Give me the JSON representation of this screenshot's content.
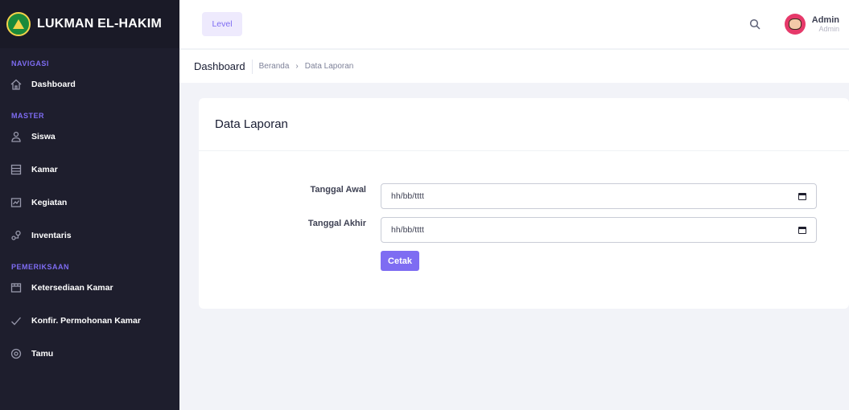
{
  "brand": {
    "name": "LUKMAN EL-HAKIM"
  },
  "header": {
    "level_label": "Level",
    "user_name": "Admin",
    "user_role": "Admin"
  },
  "sidebar": {
    "sections": [
      {
        "title": "NAVIGASI",
        "items": [
          {
            "label": "Dashboard",
            "icon": "home-icon"
          }
        ]
      },
      {
        "title": "MASTER",
        "items": [
          {
            "label": "Siswa",
            "icon": "user-icon"
          },
          {
            "label": "Kamar",
            "icon": "list-icon"
          },
          {
            "label": "Kegiatan",
            "icon": "activity-icon"
          },
          {
            "label": "Inventaris",
            "icon": "inventory-icon"
          }
        ]
      },
      {
        "title": "PEMERIKSAAN",
        "items": [
          {
            "label": "Ketersediaan Kamar",
            "icon": "room-icon"
          },
          {
            "label": "Konfir. Permohonan Kamar",
            "icon": "check-icon"
          },
          {
            "label": "Tamu",
            "icon": "target-icon"
          }
        ]
      }
    ]
  },
  "toolbar": {
    "title": "Dashboard",
    "breadcrumb": [
      "Beranda",
      "Data Laporan"
    ]
  },
  "card": {
    "title": "Data Laporan",
    "fields": [
      {
        "label": "Tanggal Awal",
        "value": "hh/bb/tttt"
      },
      {
        "label": "Tanggal Akhir",
        "value": "hh/bb/tttt"
      }
    ],
    "submit_label": "Cetak"
  },
  "colors": {
    "sidebar_bg": "#1e1e2d",
    "accent": "#7e6cf2",
    "page_bg": "#f2f3f8"
  }
}
